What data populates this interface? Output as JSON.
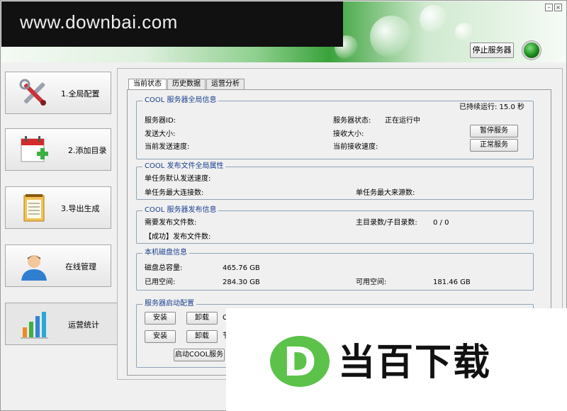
{
  "header": {
    "watermark": "www.downbai.com",
    "stop_button": "停止服务器"
  },
  "sidebar": {
    "items": [
      {
        "label": "1.全局配置",
        "icon": "tools-icon"
      },
      {
        "label": "2.添加目录",
        "icon": "calendar-add-icon"
      },
      {
        "label": "3.导出生成",
        "icon": "notepad-icon"
      },
      {
        "label": "在线管理",
        "icon": "user-icon"
      },
      {
        "label": "运营统计",
        "icon": "bar-chart-icon"
      }
    ]
  },
  "tabs": [
    "当前状态",
    "历史数据",
    "运营分析"
  ],
  "server_info": {
    "title": "COOL 服务器全局信息",
    "uptime": "已持续运行: 15.0 秒",
    "server_id_label": "服务器ID:",
    "server_status_label": "服务器状态:",
    "server_status_value": "正在运行中",
    "send_size_label": "发送大小:",
    "recv_size_label": "接收大小:",
    "send_speed_label": "当前发送速度:",
    "recv_speed_label": "当前接收速度:",
    "pause_button": "暂停服务",
    "normal_button": "正常服务"
  },
  "file_props": {
    "title": "COOL 发布文件全局属性",
    "default_speed_label": "单任务默认发送速度:",
    "max_conn_label": "单任务最大连接数:",
    "max_source_label": "单任务最大来源数:"
  },
  "publish_info": {
    "title": "COOL 服务器发布信息",
    "need_files_label": "需要发布文件数:",
    "dirs_label": "主目录数/子目录数:",
    "dirs_value": "0 / 0",
    "success_label": "【成功】发布文件数:"
  },
  "disk_info": {
    "title": "本机磁盘信息",
    "total_label": "磁盘总容量:",
    "total_value": "465.76 GB",
    "used_label": "已用空间:",
    "used_value": "284.30 GB",
    "free_label": "可用空间:",
    "free_value": "181.46 GB"
  },
  "startup": {
    "title": "服务器启动配置",
    "install_1": "安装",
    "uninstall_1": "卸载",
    "note_1": "C",
    "install_2": "安装",
    "uninstall_2": "卸载",
    "note_2": "节",
    "start_cool": "启动COOL服务"
  },
  "logo": {
    "letter": "D",
    "text": "当百下载"
  },
  "colors": {
    "accent_green": "#3aa23a",
    "group_title_blue": "#1a3f8f",
    "logo_green": "#5cc24a"
  }
}
